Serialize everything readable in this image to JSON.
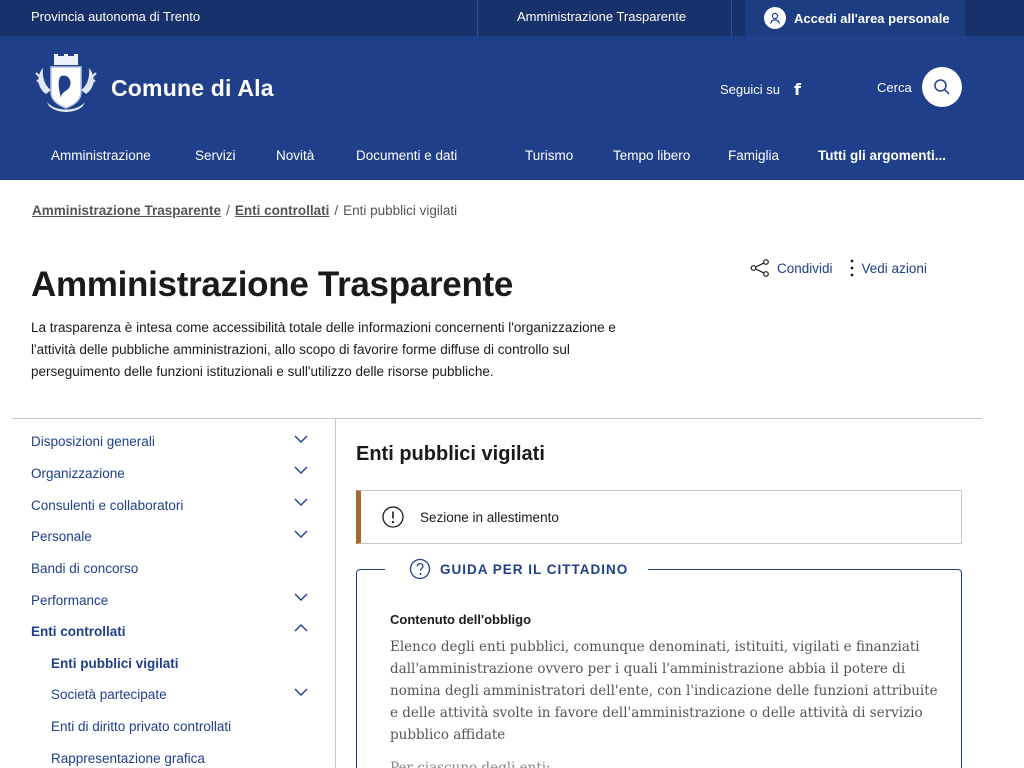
{
  "topbar": {
    "region": "Provincia autonoma di Trento",
    "transparency_link": "Amministrazione Trasparente",
    "login": "Accedi all'area personale"
  },
  "header": {
    "brand": "Comune di Ala",
    "follow_label": "Seguici su",
    "facebook_glyph": "f",
    "search_label": "Cerca"
  },
  "nav": {
    "items": [
      "Amministrazione",
      "Servizi",
      "Novità",
      "Documenti e dati",
      "Turismo",
      "Tempo libero",
      "Famiglia",
      "Tutti gli argomenti..."
    ]
  },
  "breadcrumb": {
    "items": [
      "Amministrazione Trasparente",
      "Enti controllati",
      "Enti pubblici vigilati"
    ],
    "separator": "/"
  },
  "page": {
    "title": "Amministrazione Trasparente",
    "intro": "La trasparenza è intesa come accessibilità totale delle informazioni concernenti l'organizzazione e l'attività delle pubbliche amministrazioni, allo scopo di favorire forme diffuse di controllo sul perseguimento delle funzioni istituzionali e sull'utilizzo delle risorse pubbliche.",
    "share_label": "Condividi",
    "actions_label": "Vedi azioni"
  },
  "sidebar": {
    "items": [
      {
        "label": "Disposizioni generali",
        "chevron": "down"
      },
      {
        "label": "Organizzazione",
        "chevron": "down"
      },
      {
        "label": "Consulenti e collaboratori",
        "chevron": "down"
      },
      {
        "label": "Personale",
        "chevron": "down"
      },
      {
        "label": "Bandi di concorso",
        "chevron": ""
      },
      {
        "label": "Performance",
        "chevron": "down"
      },
      {
        "label": "Enti controllati",
        "chevron": "up"
      },
      {
        "label": "Enti pubblici vigilati",
        "chevron": ""
      },
      {
        "label": "Società partecipate",
        "chevron": "down"
      },
      {
        "label": "Enti di diritto privato controllati",
        "chevron": ""
      },
      {
        "label": "Rappresentazione grafica",
        "chevron": ""
      }
    ]
  },
  "main": {
    "title": "Enti pubblici vigilati",
    "alert": "Sezione in allestimento",
    "guide": {
      "heading": "GUIDA PER IL CITTADINO",
      "subheading": "Contenuto dell'obbligo",
      "body": "Elenco degli enti pubblici, comunque denominati, istituiti, vigilati e finanziati dall'amministrazione ovvero per i quali l'amministrazione abbia il potere di nomina degli amministratori dell'ente, con l'indicazione delle funzioni attribuite e delle attività svolte in favore dell'amministrazione o delle attività di servizio pubblico affidate",
      "body_continued": "Per ciascuno degli enti:"
    }
  },
  "colors": {
    "topbar": "#17316b",
    "header": "#1f3f8a",
    "link": "#1f3f8a",
    "alert_accent": "#a66a2a"
  }
}
